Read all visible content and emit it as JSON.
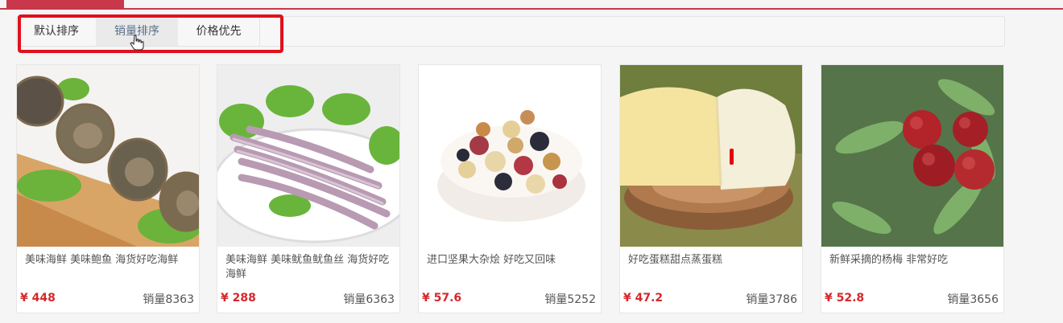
{
  "sort_tabs": [
    {
      "label": "默认排序"
    },
    {
      "label": "销量排序"
    },
    {
      "label": "价格优先"
    }
  ],
  "products": [
    {
      "name": "美味海鲜 美味鲍鱼 海货好吃海鲜",
      "price": "¥ 448",
      "sales": "销量8363",
      "image": "abalone"
    },
    {
      "name": "美味海鲜 美味鱿鱼鱿鱼丝 海货好吃海鲜",
      "price": "¥ 288",
      "sales": "销量6363",
      "image": "squid"
    },
    {
      "name": "进口坚果大杂烩 好吃又回味",
      "price": "¥ 57.6",
      "sales": "销量5252",
      "image": "mixed-nuts"
    },
    {
      "name": "好吃蛋糕甜点蒸蛋糕",
      "price": "¥ 47.2",
      "sales": "销量3786",
      "image": "steamed-cake"
    },
    {
      "name": "新鲜采摘的杨梅 非常好吃",
      "price": "¥ 52.8",
      "sales": "销量3656",
      "image": "bayberry"
    }
  ],
  "colors": {
    "accent": "#c9374a",
    "price": "#d4282d",
    "highlight": "#e0111d"
  }
}
